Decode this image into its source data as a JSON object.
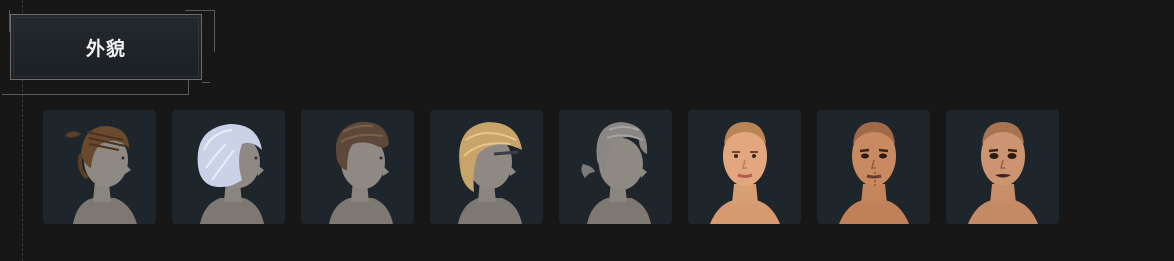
{
  "category_tab": {
    "label": "外貌"
  },
  "appearance_options": [
    {
      "kind": "hairstyle",
      "style": "braided-cornrows-updo",
      "hair_color": "#6a4a2f"
    },
    {
      "kind": "hairstyle",
      "style": "bob-white",
      "hair_color": "#c9d2e6"
    },
    {
      "kind": "hairstyle",
      "style": "short-textured",
      "hair_color": "#5d4738"
    },
    {
      "kind": "hairstyle",
      "style": "swept-blonde",
      "hair_color": "#c8a46a"
    },
    {
      "kind": "hairstyle",
      "style": "bangs-ponytail-gray",
      "hair_color": "#8a8684"
    },
    {
      "kind": "face",
      "style": "face-natural",
      "skin_color": "#e2a77e"
    },
    {
      "kind": "face",
      "style": "face-scarred",
      "skin_color": "#c98a62"
    },
    {
      "kind": "face",
      "style": "face-dark-lips",
      "skin_color": "#cc9470"
    }
  ],
  "colors": {
    "background": "#171717",
    "card_background": "#1f262b",
    "tab_background": "#22272b",
    "tab_border": "#6c6c6c",
    "bust_gray": "#8b857f"
  }
}
